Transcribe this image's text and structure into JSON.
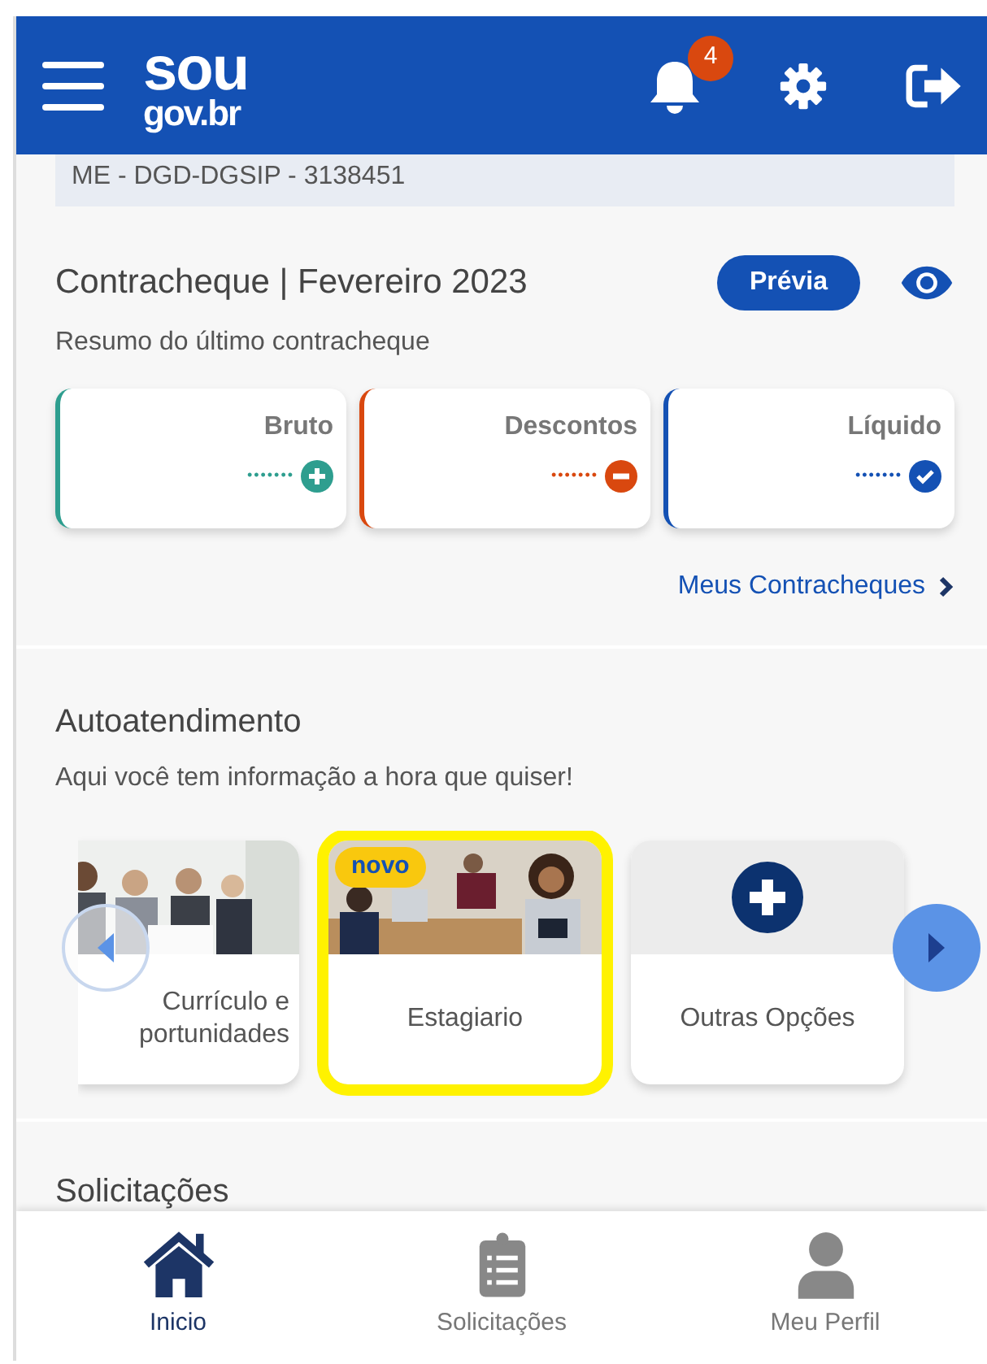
{
  "header": {
    "logo_top": "sou",
    "logo_bottom": "gov.br",
    "notifications": "4"
  },
  "user_info": {
    "line": "ME - DGD-DGSIP - 3138451"
  },
  "payslip": {
    "title": "Contracheque | Fevereiro 2023",
    "preview_button": "Prévia",
    "subtitle": "Resumo do último contracheque",
    "cards": [
      {
        "label": "Bruto",
        "value": "•••••••",
        "kind": "plus",
        "color": "#2e9e8f"
      },
      {
        "label": "Descontos",
        "value": "•••••••",
        "kind": "minus",
        "color": "#d9480f"
      },
      {
        "label": "Líquido",
        "value": "•••••••",
        "kind": "check",
        "color": "#1451b4"
      }
    ],
    "link": "Meus Contracheques"
  },
  "self_service": {
    "title": "Autoatendimento",
    "subtitle": "Aqui você tem informação a hora que quiser!",
    "cards": [
      {
        "lines": [
          "Currículo e",
          "portunidades"
        ],
        "kind": "picture",
        "selected": false
      },
      {
        "lines": [
          "Estagiario"
        ],
        "kind": "picture",
        "selected": true,
        "badge": "novo"
      },
      {
        "lines": [
          "Outras Opções"
        ],
        "kind": "add",
        "selected": false
      }
    ]
  },
  "next_section": {
    "title": "Solicitações"
  },
  "bottom_nav": [
    {
      "label": "Inicio",
      "kind": "home",
      "selected": true
    },
    {
      "label": "Solicitações",
      "kind": "clipboard",
      "selected": false
    },
    {
      "label": "Meu Perfil",
      "kind": "person",
      "selected": false
    }
  ]
}
